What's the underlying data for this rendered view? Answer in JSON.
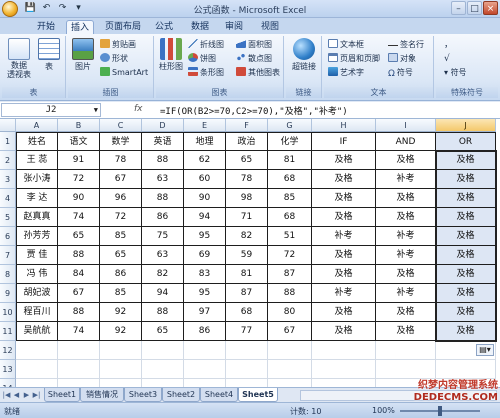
{
  "window": {
    "title": "公式函数 - Microsoft Excel",
    "minimize": "–",
    "maximize": "□",
    "close": "×"
  },
  "ribbon_tabs": [
    "开始",
    "插入",
    "页面布局",
    "公式",
    "数据",
    "审阅",
    "视图"
  ],
  "active_tab": "插入",
  "ribbon": {
    "groups": {
      "tables": "表",
      "illustrations": "插图",
      "charts": "图表",
      "links": "链接",
      "text": "文本",
      "symbols": "特殊符号"
    },
    "buttons": {
      "pivot_table": "数据\n透视表",
      "table": "表",
      "picture": "图片",
      "clip_art": "剪贴画",
      "shapes": "形状",
      "smartart": "SmartArt",
      "column_chart": "柱形图",
      "line_chart": "折线图",
      "pie_chart": "饼图",
      "bar_chart": "条形图",
      "area_chart": "面积图",
      "scatter_chart": "散点图",
      "other_charts": "其他图表",
      "hyperlink": "超链接",
      "textbox": "文本框",
      "header_footer": "页眉和页脚",
      "wordart": "艺术字",
      "signature_line": "签名行",
      "object": "对象",
      "symbol": "符号",
      "special_symbol": "符号"
    }
  },
  "formula_bar": {
    "name_box": "J2",
    "fx": "fx",
    "formula": "=IF(OR(B2>=70,C2>=70),\"及格\",\"补考\")"
  },
  "sheet": {
    "columns": [
      "A",
      "B",
      "C",
      "D",
      "E",
      "F",
      "G",
      "H",
      "I",
      "J"
    ],
    "selected_column": "J",
    "header_row": [
      "姓名",
      "语文",
      "数学",
      "英语",
      "地理",
      "政治",
      "化学",
      "IF",
      "AND",
      "OR"
    ],
    "rows": [
      [
        "王  蕊",
        "91",
        "78",
        "88",
        "62",
        "65",
        "81",
        "及格",
        "及格",
        "及格"
      ],
      [
        "张小涛",
        "72",
        "67",
        "63",
        "60",
        "78",
        "68",
        "及格",
        "补考",
        "及格"
      ],
      [
        "李  达",
        "90",
        "96",
        "88",
        "90",
        "98",
        "85",
        "及格",
        "及格",
        "及格"
      ],
      [
        "赵真真",
        "74",
        "72",
        "86",
        "94",
        "71",
        "68",
        "及格",
        "及格",
        "及格"
      ],
      [
        "孙芳芳",
        "65",
        "85",
        "75",
        "95",
        "82",
        "51",
        "补考",
        "补考",
        "及格"
      ],
      [
        "贾  佳",
        "88",
        "65",
        "63",
        "69",
        "59",
        "72",
        "及格",
        "补考",
        "及格"
      ],
      [
        "冯  伟",
        "84",
        "86",
        "82",
        "83",
        "81",
        "87",
        "及格",
        "及格",
        "及格"
      ],
      [
        "胡妃波",
        "67",
        "85",
        "94",
        "95",
        "87",
        "88",
        "补考",
        "补考",
        "及格"
      ],
      [
        "程百川",
        "88",
        "92",
        "88",
        "97",
        "68",
        "80",
        "及格",
        "及格",
        "及格"
      ],
      [
        "吴航航",
        "74",
        "92",
        "65",
        "86",
        "77",
        "67",
        "及格",
        "及格",
        "及格"
      ]
    ],
    "row_numbers": [
      "1",
      "2",
      "3",
      "4",
      "5",
      "6",
      "7",
      "8",
      "9",
      "10",
      "11",
      "12",
      "13",
      "14"
    ]
  },
  "sheet_tabs": [
    "Sheet1",
    "销售情况",
    "Sheet3",
    "Sheet2",
    "Sheet4",
    "Sheet5"
  ],
  "active_sheet": "Sheet5",
  "status": {
    "ready": "就绪",
    "count": "计数: 10",
    "zoom": "100%"
  },
  "watermark": {
    "text": "织梦内容管理系统",
    "url": "DEDECMS.COM"
  },
  "colors": {
    "selected_column_fill": "#dde6f4",
    "selected_header": "#f4c86a"
  }
}
